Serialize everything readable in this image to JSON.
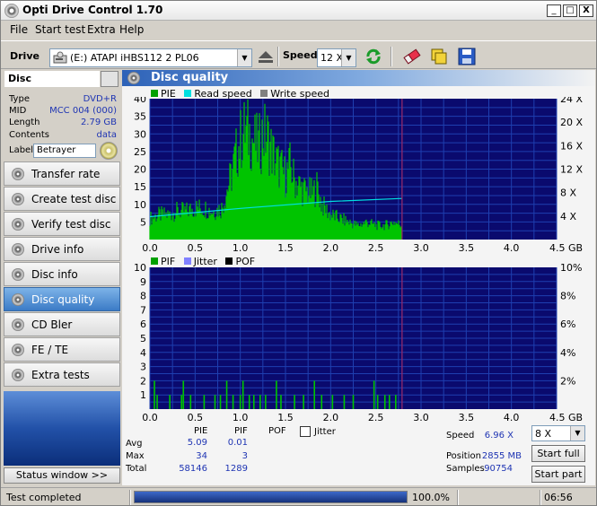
{
  "window": {
    "title": "Opti Drive Control 1.70",
    "min": "_",
    "max": "□",
    "close": "X"
  },
  "menu": [
    "File",
    "Start test",
    "Extra",
    "Help"
  ],
  "toolbar": {
    "drive_label": "Drive",
    "drive_value": "(E:)   ATAPI  iHBS112   2 PL06",
    "speed_label": "Speed",
    "speed_value": "12 X"
  },
  "disc": {
    "header": "Disc",
    "rows": [
      {
        "k": "Type",
        "v": "DVD+R"
      },
      {
        "k": "MID",
        "v": "MCC 004 (000)"
      },
      {
        "k": "Length",
        "v": "2.79 GB"
      },
      {
        "k": "Contents",
        "v": "data"
      }
    ],
    "label_key": "Label",
    "label_value": "Betrayer"
  },
  "nav": [
    "Transfer rate",
    "Create test disc",
    "Verify test disc",
    "Drive info",
    "Disc info",
    "Disc quality",
    "CD Bler",
    "FE / TE",
    "Extra tests"
  ],
  "nav_active": 5,
  "status_window_label": "Status window >>",
  "panel_title": "Disc quality",
  "colors": {
    "pie": "#00c400",
    "read": "#00e0e0",
    "write": "#808080",
    "pif": "#00c400",
    "jitter": "#8080ff",
    "pof": "#000000",
    "plot_bg": "#0a0a6e",
    "grid": "#1e3fb0"
  },
  "chart_data": [
    {
      "type": "area",
      "title": "",
      "legend": [
        "PIE",
        "Read speed",
        "Write speed"
      ],
      "x_ticks": [
        "0.0",
        "0.5",
        "1.0",
        "1.5",
        "2.0",
        "2.5",
        "3.0",
        "3.5",
        "4.0",
        "4.5 GB"
      ],
      "y_ticks_left": [
        "5",
        "10",
        "15",
        "20",
        "25",
        "30",
        "35",
        "40"
      ],
      "y_ticks_right": [
        "4 X",
        "8 X",
        "12 X",
        "16 X",
        "20 X",
        "24 X"
      ],
      "xlim": [
        0,
        4.5
      ],
      "ylim": [
        0,
        40
      ],
      "y2lim": [
        0,
        24
      ],
      "disc_end": 2.79,
      "pie_profile": [
        [
          0.0,
          6
        ],
        [
          0.1,
          7
        ],
        [
          0.2,
          7
        ],
        [
          0.3,
          8
        ],
        [
          0.4,
          8
        ],
        [
          0.5,
          9
        ],
        [
          0.6,
          9
        ],
        [
          0.7,
          8
        ],
        [
          0.8,
          9
        ],
        [
          0.85,
          14
        ],
        [
          0.9,
          18
        ],
        [
          0.95,
          24
        ],
        [
          1.0,
          28
        ],
        [
          1.05,
          31
        ],
        [
          1.1,
          30
        ],
        [
          1.15,
          28
        ],
        [
          1.2,
          26
        ],
        [
          1.25,
          30
        ],
        [
          1.3,
          29
        ],
        [
          1.35,
          25
        ],
        [
          1.4,
          22
        ],
        [
          1.45,
          20
        ],
        [
          1.5,
          18
        ],
        [
          1.55,
          21
        ],
        [
          1.6,
          17
        ],
        [
          1.7,
          14
        ],
        [
          1.8,
          13
        ],
        [
          1.85,
          15
        ],
        [
          1.9,
          10
        ],
        [
          2.0,
          7
        ],
        [
          2.1,
          6
        ],
        [
          2.2,
          5
        ],
        [
          2.3,
          4
        ],
        [
          2.4,
          5
        ],
        [
          2.5,
          4
        ],
        [
          2.6,
          4
        ],
        [
          2.7,
          5
        ],
        [
          2.79,
          4
        ]
      ],
      "read_speed": [
        [
          0.0,
          3.9
        ],
        [
          1.0,
          5.3
        ],
        [
          2.0,
          6.5
        ],
        [
          2.79,
          7.0
        ]
      ]
    },
    {
      "type": "bar",
      "title": "",
      "legend": [
        "PIF",
        "Jitter",
        "POF"
      ],
      "x_ticks": [
        "0.0",
        "0.5",
        "1.0",
        "1.5",
        "2.0",
        "2.5",
        "3.0",
        "3.5",
        "4.0",
        "4.5 GB"
      ],
      "y_ticks_left": [
        "1",
        "2",
        "3",
        "4",
        "5",
        "6",
        "7",
        "8",
        "9",
        "10"
      ],
      "y_ticks_right": [
        "2%",
        "4%",
        "6%",
        "8%",
        "10%"
      ],
      "xlim": [
        0,
        4.5
      ],
      "ylim": [
        0,
        10
      ],
      "disc_end": 2.79,
      "pif_bars": [
        [
          0.05,
          2
        ],
        [
          0.08,
          1
        ],
        [
          0.22,
          1
        ],
        [
          0.35,
          1
        ],
        [
          0.37,
          2
        ],
        [
          0.45,
          1
        ],
        [
          0.6,
          1
        ],
        [
          0.72,
          1
        ],
        [
          0.78,
          1
        ],
        [
          0.85,
          2
        ],
        [
          0.92,
          1
        ],
        [
          1.0,
          1
        ],
        [
          1.03,
          2
        ],
        [
          1.1,
          1
        ],
        [
          1.15,
          1
        ],
        [
          1.22,
          1
        ],
        [
          1.28,
          1
        ],
        [
          1.4,
          2
        ],
        [
          1.45,
          1
        ],
        [
          1.6,
          1
        ],
        [
          1.7,
          1
        ],
        [
          1.82,
          2
        ],
        [
          1.9,
          1
        ],
        [
          2.02,
          1
        ],
        [
          2.15,
          1
        ],
        [
          2.25,
          1
        ],
        [
          2.48,
          2
        ],
        [
          2.52,
          1
        ],
        [
          2.6,
          1
        ],
        [
          2.65,
          1
        ],
        [
          2.72,
          1
        ]
      ]
    }
  ],
  "stats": {
    "col_pie": "PIE",
    "col_pif": "PIF",
    "col_pof": "POF",
    "jitter_label": "Jitter",
    "avg_label": "Avg",
    "max_label": "Max",
    "total_label": "Total",
    "pie_avg": "5.09",
    "pif_avg": "0.01",
    "pie_max": "34",
    "pif_max": "3",
    "pie_total": "58146",
    "pif_total": "1289",
    "speed_label": "Speed",
    "speed_value": "6.96 X",
    "position_label": "Position",
    "position_value": "2855 MB",
    "samples_label": "Samples",
    "samples_value": "90754",
    "speed_select": "8 X",
    "start_full": "Start full",
    "start_part": "Start part"
  },
  "statusbar": {
    "text": "Test completed",
    "progress": 1.0,
    "percent": "100.0%",
    "time": "06:56"
  }
}
